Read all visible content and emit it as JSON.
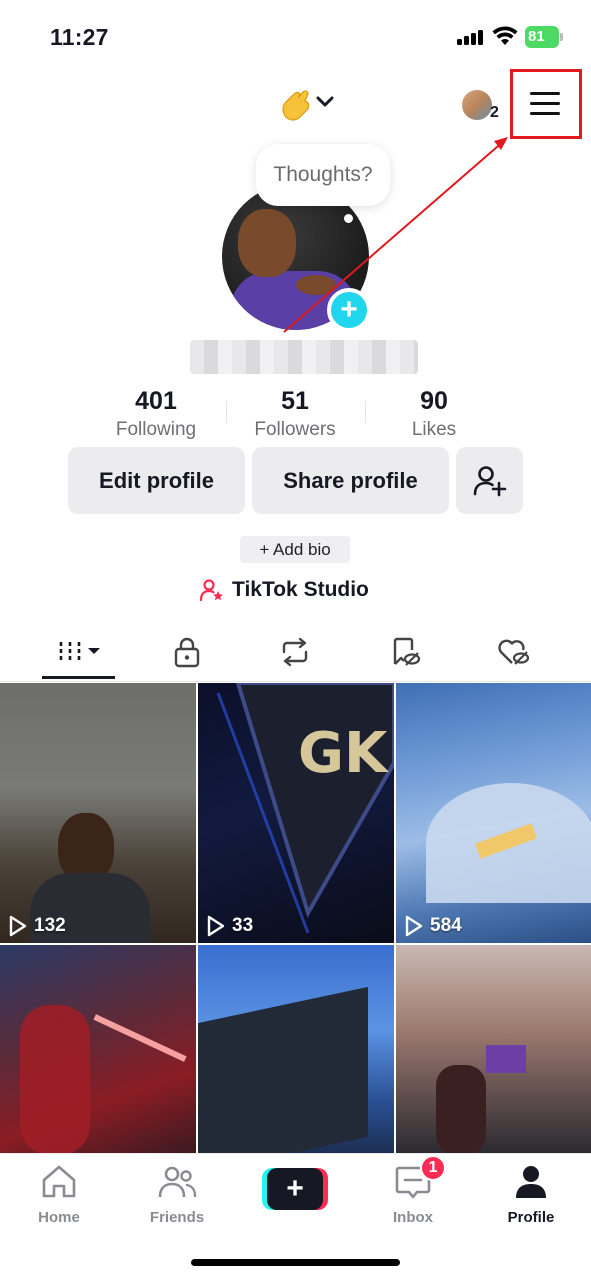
{
  "status_bar": {
    "time": "11:27",
    "battery_level": "81"
  },
  "header": {
    "status_emoji": "🤌",
    "friend_count": "2"
  },
  "profile": {
    "thought_placeholder": "Thoughts?",
    "stats": [
      {
        "value": "401",
        "label": "Following"
      },
      {
        "value": "51",
        "label": "Followers"
      },
      {
        "value": "90",
        "label": "Likes"
      }
    ],
    "edit_profile_label": "Edit profile",
    "share_profile_label": "Share profile",
    "add_bio_label": "+ Add bio",
    "studio_label": "TikTok Studio"
  },
  "tabs": [
    {
      "icon": "videos-grid-icon",
      "active": true
    },
    {
      "icon": "lock-icon"
    },
    {
      "icon": "repost-icon"
    },
    {
      "icon": "favorites-icon"
    },
    {
      "icon": "liked-icon"
    }
  ],
  "videos": [
    {
      "views": "132"
    },
    {
      "views": "33",
      "overlay_text": "GK"
    },
    {
      "views": "584"
    },
    {
      "views": ""
    },
    {
      "views": ""
    },
    {
      "views": ""
    }
  ],
  "bottom_nav": {
    "items": [
      {
        "label": "Home",
        "icon": "home-icon"
      },
      {
        "label": "Friends",
        "icon": "friends-icon"
      },
      {
        "label": "",
        "icon": "create-plus-icon"
      },
      {
        "label": "Inbox",
        "icon": "inbox-icon"
      },
      {
        "label": "Profile",
        "icon": "profile-icon",
        "active": true
      }
    ],
    "inbox_badge": "1"
  },
  "colors": {
    "accent_cyan": "#20d5ec",
    "accent_pink": "#fe2c55",
    "annotation_red": "#e0191f"
  }
}
